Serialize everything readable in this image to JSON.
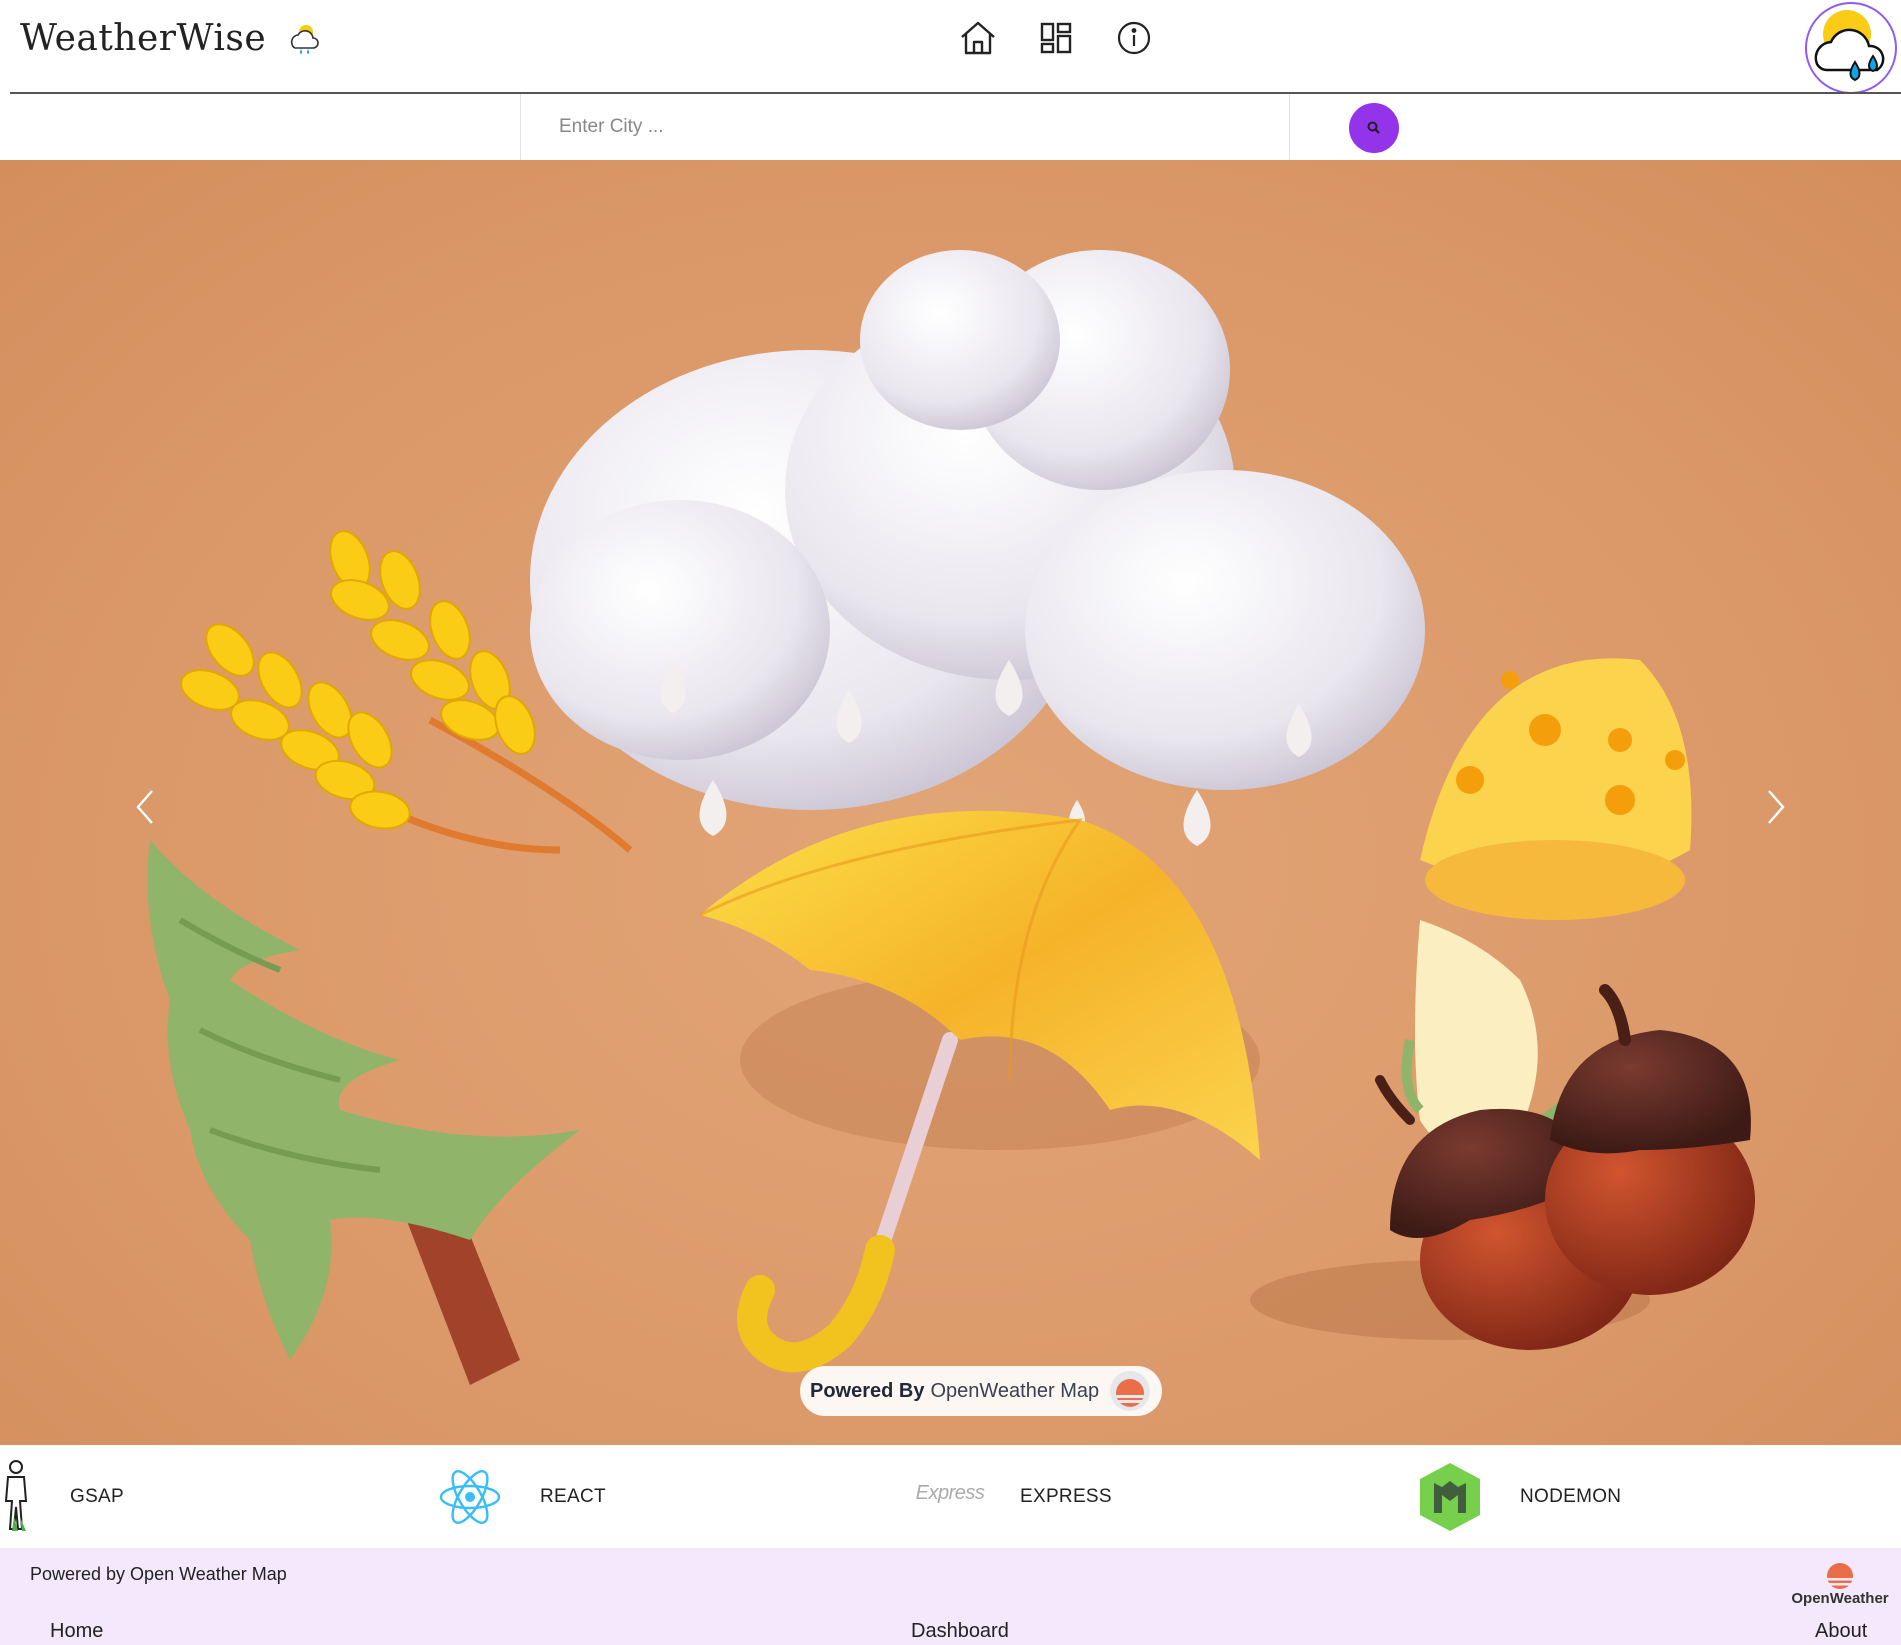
{
  "header": {
    "brand_title": "WeatherWise",
    "nav": [
      {
        "name": "home",
        "icon": "home-icon"
      },
      {
        "name": "dashboard",
        "icon": "dashboard-grid-icon"
      },
      {
        "name": "about",
        "icon": "info-icon"
      }
    ],
    "avatar_icon": "cloud-sun-rain-icon"
  },
  "search": {
    "placeholder": "Enter City ...",
    "value": "",
    "button_icon": "search-icon",
    "button_color": "#9333ea"
  },
  "hero": {
    "powered_bold": "Powered By",
    "powered_rest": "OpenWeather Map",
    "prev_icon": "chevron-left-icon",
    "next_icon": "chevron-right-icon"
  },
  "tech": [
    {
      "label": "GSAP",
      "icon": "gsap-icon"
    },
    {
      "label": "REACT",
      "icon": "react-icon"
    },
    {
      "label": "EXPRESS",
      "icon": "express-icon",
      "logo_text": "Express"
    },
    {
      "label": "NODEMON",
      "icon": "nodemon-icon"
    }
  ],
  "footer": {
    "powered_text": "Powered by Open Weather Map",
    "logo_text": "OpenWeather",
    "links": {
      "home": "Home",
      "dashboard": "Dashboard",
      "about": "About"
    },
    "background": "#f3e8fc"
  }
}
